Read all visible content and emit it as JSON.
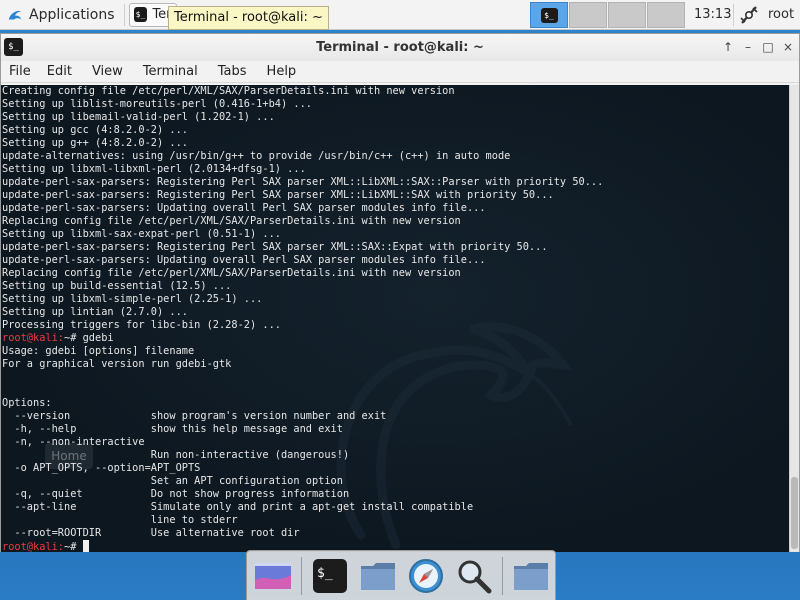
{
  "top_panel": {
    "applications_label": "Applications",
    "task_label": "Ter",
    "tooltip": "Terminal - root@kali: ~",
    "clock": "13:13",
    "user": "root"
  },
  "window": {
    "title": "Terminal - root@kali: ~",
    "menu": [
      "File",
      "Edit",
      "View",
      "Terminal",
      "Tabs",
      "Help"
    ],
    "controls": [
      "↑",
      "–",
      "□",
      "×"
    ]
  },
  "terminal": {
    "lines": [
      {
        "text": "Creating config file /etc/perl/XML/SAX/ParserDetails.ini with new version"
      },
      {
        "text": "Setting up liblist-moreutils-perl (0.416-1+b4) ..."
      },
      {
        "text": "Setting up libemail-valid-perl (1.202-1) ..."
      },
      {
        "text": "Setting up gcc (4:8.2.0-2) ..."
      },
      {
        "text": "Setting up g++ (4:8.2.0-2) ..."
      },
      {
        "text": "update-alternatives: using /usr/bin/g++ to provide /usr/bin/c++ (c++) in auto mode"
      },
      {
        "text": "Setting up libxml-libxml-perl (2.0134+dfsg-1) ..."
      },
      {
        "text": "update-perl-sax-parsers: Registering Perl SAX parser XML::LibXML::SAX::Parser with priority 50..."
      },
      {
        "text": "update-perl-sax-parsers: Registering Perl SAX parser XML::LibXML::SAX with priority 50..."
      },
      {
        "text": "update-perl-sax-parsers: Updating overall Perl SAX parser modules info file..."
      },
      {
        "text": "Replacing config file /etc/perl/XML/SAX/ParserDetails.ini with new version"
      },
      {
        "text": "Setting up libxml-sax-expat-perl (0.51-1) ..."
      },
      {
        "text": "update-perl-sax-parsers: Registering Perl SAX parser XML::SAX::Expat with priority 50..."
      },
      {
        "text": "update-perl-sax-parsers: Updating overall Perl SAX parser modules info file..."
      },
      {
        "text": "Replacing config file /etc/perl/XML/SAX/ParserDetails.ini with new version"
      },
      {
        "text": "Setting up build-essential (12.5) ..."
      },
      {
        "text": "Setting up libxml-simple-perl (2.25-1) ..."
      },
      {
        "text": "Setting up lintian (2.7.0) ..."
      },
      {
        "text": "Processing triggers for libc-bin (2.28-2) ..."
      },
      {
        "prompt": "root@kali:",
        "text": "~# gdebi"
      },
      {
        "text": "Usage: gdebi [options] filename"
      },
      {
        "text": "For a graphical version run gdebi-gtk"
      },
      {
        "text": ""
      },
      {
        "text": ""
      },
      {
        "text": "Options:"
      },
      {
        "text": "  --version             show program's version number and exit"
      },
      {
        "text": "  -h, --help            show this help message and exit"
      },
      {
        "text": "  -n, --non-interactive"
      },
      {
        "text": "                        Run non-interactive (dangerous!)"
      },
      {
        "text": "  -o APT_OPTS, --option=APT_OPTS"
      },
      {
        "text": "                        Set an APT configuration option"
      },
      {
        "text": "  -q, --quiet           Do not show progress information"
      },
      {
        "text": "  --apt-line            Simulate only and print a apt-get install compatible"
      },
      {
        "text": "                        line to stderr"
      },
      {
        "text": "  --root=ROOTDIR        Use alternative root dir"
      },
      {
        "prompt": "root@kali:",
        "text": "~# ",
        "cursor": true
      }
    ],
    "ghost_label": "Home"
  },
  "dock": {
    "items": [
      "desktop-icon",
      "terminal-icon",
      "folder-icon",
      "browser-icon",
      "search-icon",
      "folder-icon"
    ]
  }
}
